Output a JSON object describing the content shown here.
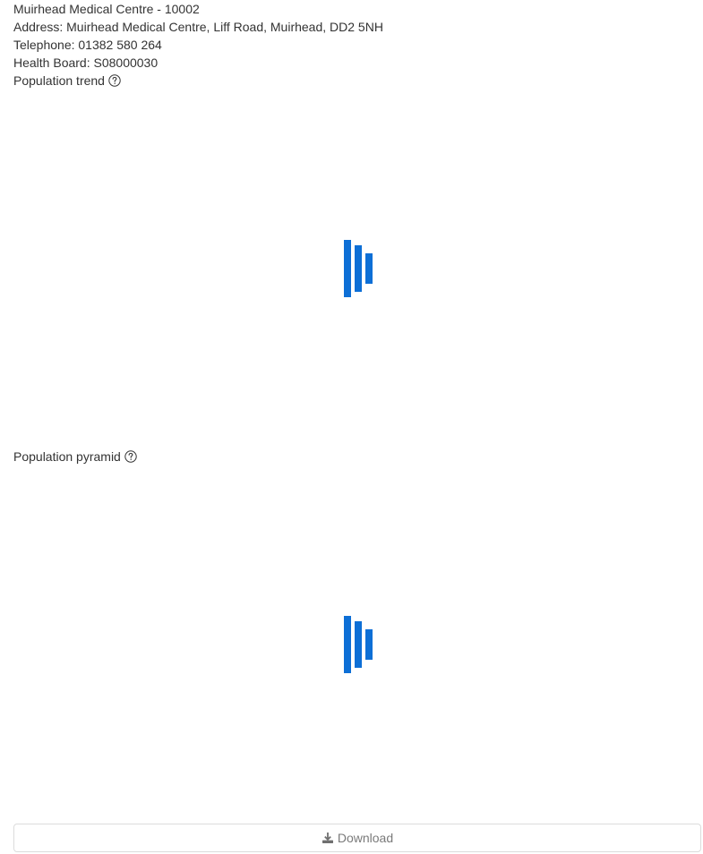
{
  "practice": {
    "name": "Muirhead Medical Centre - 10002",
    "address": "Address: Muirhead Medical Centre, Liff Road, Muirhead, DD2 5NH",
    "telephone": "Telephone: 01382 580 264",
    "health_board": "Health Board: S08000030"
  },
  "sections": {
    "trend": {
      "title": "Population trend",
      "help_icon": "question-circle-icon",
      "state": "loading"
    },
    "pyramid": {
      "title": "Population pyramid",
      "help_icon": "question-circle-icon",
      "state": "loading"
    }
  },
  "actions": {
    "download_label": "Download",
    "download_icon": "download-icon"
  },
  "colors": {
    "loader": "#0d6fd6",
    "text": "#333333",
    "button_text": "#7a7a7a",
    "button_border": "#dcdcdc"
  }
}
